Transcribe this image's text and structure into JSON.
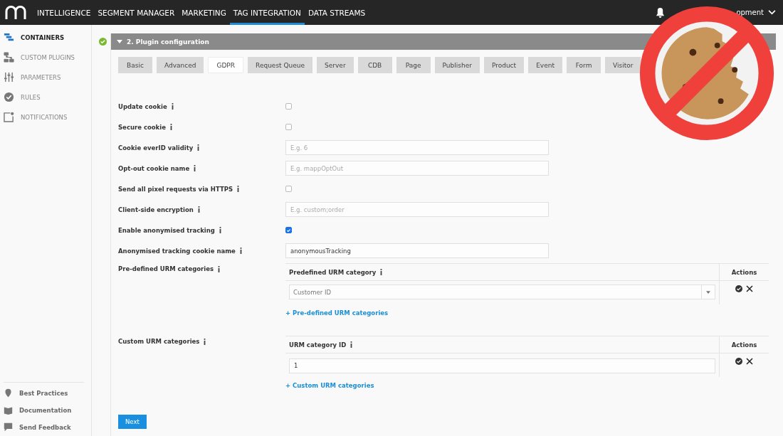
{
  "top_nav": {
    "items": [
      {
        "label": "INTELLIGENCE",
        "selected": false
      },
      {
        "label": "SEGMENT MANAGER",
        "selected": false
      },
      {
        "label": "MARKETING",
        "selected": false
      },
      {
        "label": "TAG INTEGRATION",
        "selected": true
      },
      {
        "label": "DATA STREAMS",
        "selected": false
      }
    ],
    "account": "opment"
  },
  "sidebar": {
    "items": [
      {
        "label": "CONTAINERS",
        "selected": true
      },
      {
        "label": "CUSTOM PLUGINS",
        "selected": false
      },
      {
        "label": "PARAMETERS",
        "selected": false
      },
      {
        "label": "RULES",
        "selected": false
      },
      {
        "label": "NOTIFICATIONS",
        "selected": false
      }
    ],
    "footer": [
      {
        "label": "Best Practices"
      },
      {
        "label": "Documentation"
      },
      {
        "label": "Send Feedback"
      }
    ]
  },
  "section": {
    "title": "2. Plugin configuration",
    "complete": true
  },
  "tabs": [
    {
      "label": "Basic",
      "selected": false
    },
    {
      "label": "Advanced",
      "selected": false
    },
    {
      "label": "GDPR",
      "selected": true
    },
    {
      "label": "Request Queue",
      "selected": false
    },
    {
      "label": "Server",
      "selected": false
    },
    {
      "label": "CDB",
      "selected": false
    },
    {
      "label": "Page",
      "selected": false
    },
    {
      "label": "Publisher",
      "selected": false
    },
    {
      "label": "Product",
      "selected": false
    },
    {
      "label": "Event",
      "selected": false
    },
    {
      "label": "Form",
      "selected": false
    },
    {
      "label": "Visitor",
      "selected": false
    }
  ],
  "fields": [
    {
      "label": "Update cookie",
      "kind": "checkbox",
      "checked": false
    },
    {
      "label": "Secure cookie",
      "kind": "checkbox",
      "checked": false
    },
    {
      "label": "Cookie everID validity",
      "kind": "text",
      "placeholder": "E.g. 6"
    },
    {
      "label": "Opt-out cookie name",
      "kind": "text",
      "placeholder": "E.g. mappOptOut"
    },
    {
      "label": "Send all pixel requests via HTTPS",
      "kind": "checkbox",
      "checked": false
    },
    {
      "label": "Client-side encryption",
      "kind": "text",
      "placeholder": "E.g. custom;order"
    },
    {
      "label": "Enable anonymised tracking",
      "kind": "checkbox",
      "checked": true
    },
    {
      "label": "Anonymised tracking cookie name",
      "kind": "text",
      "value": "anonymousTracking"
    }
  ],
  "tables": [
    {
      "label": "Pre-defined URM categories",
      "kind": "select",
      "column": "Predefined URM category",
      "actions": "Actions",
      "rows": [
        "Customer ID"
      ],
      "add": "+ Pre-defined URM categories"
    },
    {
      "label": "Custom URM categories",
      "kind": "text",
      "column": "URM category ID",
      "actions": "Actions",
      "rows": [
        "1"
      ],
      "add": "+ Custom URM categories"
    }
  ],
  "next_button": "Next"
}
